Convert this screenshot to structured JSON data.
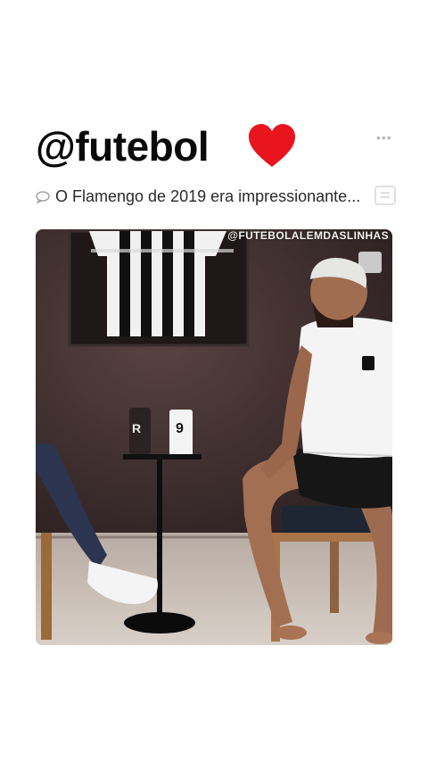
{
  "post": {
    "handle": "@futebol",
    "more_label": "•••",
    "caption": "O Flamengo de 2019 era impressionante..."
  },
  "video": {
    "watermark": "@FUTEBOLALEMDASLINHAS",
    "cup_number": "9"
  },
  "colors": {
    "heart": "#e8141e",
    "wall": "#3a2c2c",
    "floor": "#c9bfb6"
  },
  "icons": [
    "heart-icon",
    "more-icon",
    "speech-bubble-icon",
    "share-icon"
  ]
}
